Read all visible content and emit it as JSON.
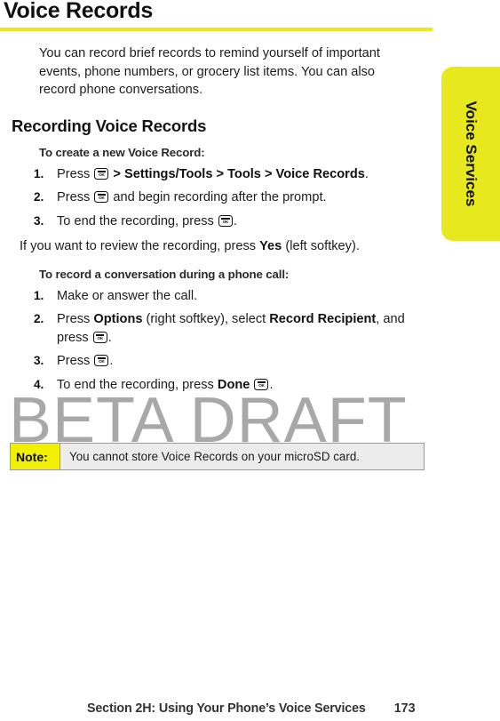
{
  "page": {
    "title": "Voice Records",
    "watermark": "BETA DRAFT",
    "rule_color": "#e8e81e"
  },
  "side_tab": {
    "label": "Voice Services",
    "color": "#e8e81e"
  },
  "intro": {
    "paragraph": "You can record brief records to remind yourself of important events, phone numbers, or grocery list items. You can also record phone conversations."
  },
  "section": {
    "heading": "Recording Voice Records"
  },
  "procedure_1": {
    "lead": "To create a new Voice Record:",
    "steps": [
      {
        "num": "1.",
        "parts": [
          {
            "t": "text",
            "v": "Press "
          },
          {
            "t": "key",
            "v": "OK"
          },
          {
            "t": "bold",
            "v": " > Settings/Tools > Tools > Voice Records"
          },
          {
            "t": "text",
            "v": "."
          }
        ]
      },
      {
        "num": "2.",
        "parts": [
          {
            "t": "text",
            "v": "Press "
          },
          {
            "t": "key",
            "v": "OK"
          },
          {
            "t": "text",
            "v": " and begin recording after the prompt."
          }
        ]
      },
      {
        "num": "3.",
        "parts": [
          {
            "t": "text",
            "v": "To end the recording, press "
          },
          {
            "t": "key",
            "v": "OK"
          },
          {
            "t": "text",
            "v": "."
          }
        ]
      }
    ],
    "follow_up": [
      {
        "t": "text",
        "v": "If you want to review the recording, press "
      },
      {
        "t": "bold",
        "v": "Yes"
      },
      {
        "t": "text",
        "v": " (left softkey)."
      }
    ]
  },
  "procedure_2": {
    "lead": "To record a conversation during a phone call:",
    "steps": [
      {
        "num": "1.",
        "parts": [
          {
            "t": "text",
            "v": "Make or answer the call."
          }
        ]
      },
      {
        "num": "2.",
        "parts": [
          {
            "t": "text",
            "v": "Press "
          },
          {
            "t": "bold",
            "v": "Options"
          },
          {
            "t": "text",
            "v": " (right softkey), select "
          },
          {
            "t": "bold",
            "v": "Record Recipient"
          },
          {
            "t": "text",
            "v": ", and press "
          },
          {
            "t": "key",
            "v": "OK"
          },
          {
            "t": "text",
            "v": "."
          }
        ]
      },
      {
        "num": "3.",
        "parts": [
          {
            "t": "text",
            "v": "Press "
          },
          {
            "t": "key",
            "v": "OK"
          },
          {
            "t": "text",
            "v": "."
          }
        ]
      },
      {
        "num": "4.",
        "parts": [
          {
            "t": "text",
            "v": "To end the recording, press "
          },
          {
            "t": "bold",
            "v": "Done"
          },
          {
            "t": "text",
            "v": " "
          },
          {
            "t": "key",
            "v": "OK"
          },
          {
            "t": "text",
            "v": "."
          }
        ]
      }
    ]
  },
  "note": {
    "label": "Note:",
    "text": "You cannot store Voice Records on your microSD card.",
    "label_color": "#f0f000",
    "body_color": "#ececec"
  },
  "footer": {
    "section": "Section 2H: Using Your Phone’s Voice Services",
    "page_number": "173"
  }
}
